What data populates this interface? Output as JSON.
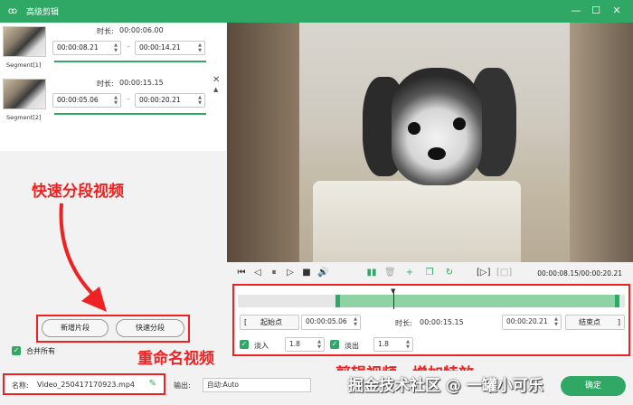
{
  "window": {
    "title": "高级剪辑",
    "minimize": "—",
    "maximize": "☐",
    "close": "✕"
  },
  "segments": [
    {
      "label": "Segment[1]",
      "duration_label": "时长:",
      "duration": "00:00:06.00",
      "start": "00:00:08.21",
      "end": "00:00:14.21"
    },
    {
      "label": "Segment[2]",
      "duration_label": "时长:",
      "duration": "00:00:15.15",
      "start": "00:00:05.06",
      "end": "00:00:20.21"
    }
  ],
  "annotations": {
    "quick_split": "快速分段视频",
    "rename": "重命名视频",
    "trim": "剪辑视频，增加特效"
  },
  "left_buttons": {
    "add_segment": "新增片段",
    "quick_split": "快速分段"
  },
  "merge_all": {
    "label": "合并所有",
    "checked": true
  },
  "player": {
    "time_readout": "00:00:08.15/00:00:20.21",
    "icons": [
      "skip-start-icon",
      "step-back-icon",
      "pause-icon",
      "step-forward-icon",
      "stop-icon",
      "volume-icon",
      "split-icon",
      "delete-icon",
      "add-icon",
      "copy-icon",
      "reset-icon",
      "crop-icon",
      "fit-icon"
    ]
  },
  "trim": {
    "start_button": "起始点",
    "start_time": "00:00:05.06",
    "duration_label": "时长:",
    "duration": "00:00:15.15",
    "end_time": "00:00:20.21",
    "end_button": "结束点",
    "fade_in_label": "淡入",
    "fade_in_value": "1.8",
    "fade_out_label": "淡出",
    "fade_out_value": "1.8",
    "selection_start_fraction": 0.25,
    "selection_end_fraction": 1.0
  },
  "bottom": {
    "name_label": "名称:",
    "name_value": "Video_250417170923.mp4",
    "output_label": "输出:",
    "output_value": "自动:Auto",
    "watermark": "掘金技术社区 @ 一罐小可乐",
    "action_button": "确定"
  },
  "colors": {
    "accent": "#2fa866",
    "annotation_red": "#ee2222"
  }
}
